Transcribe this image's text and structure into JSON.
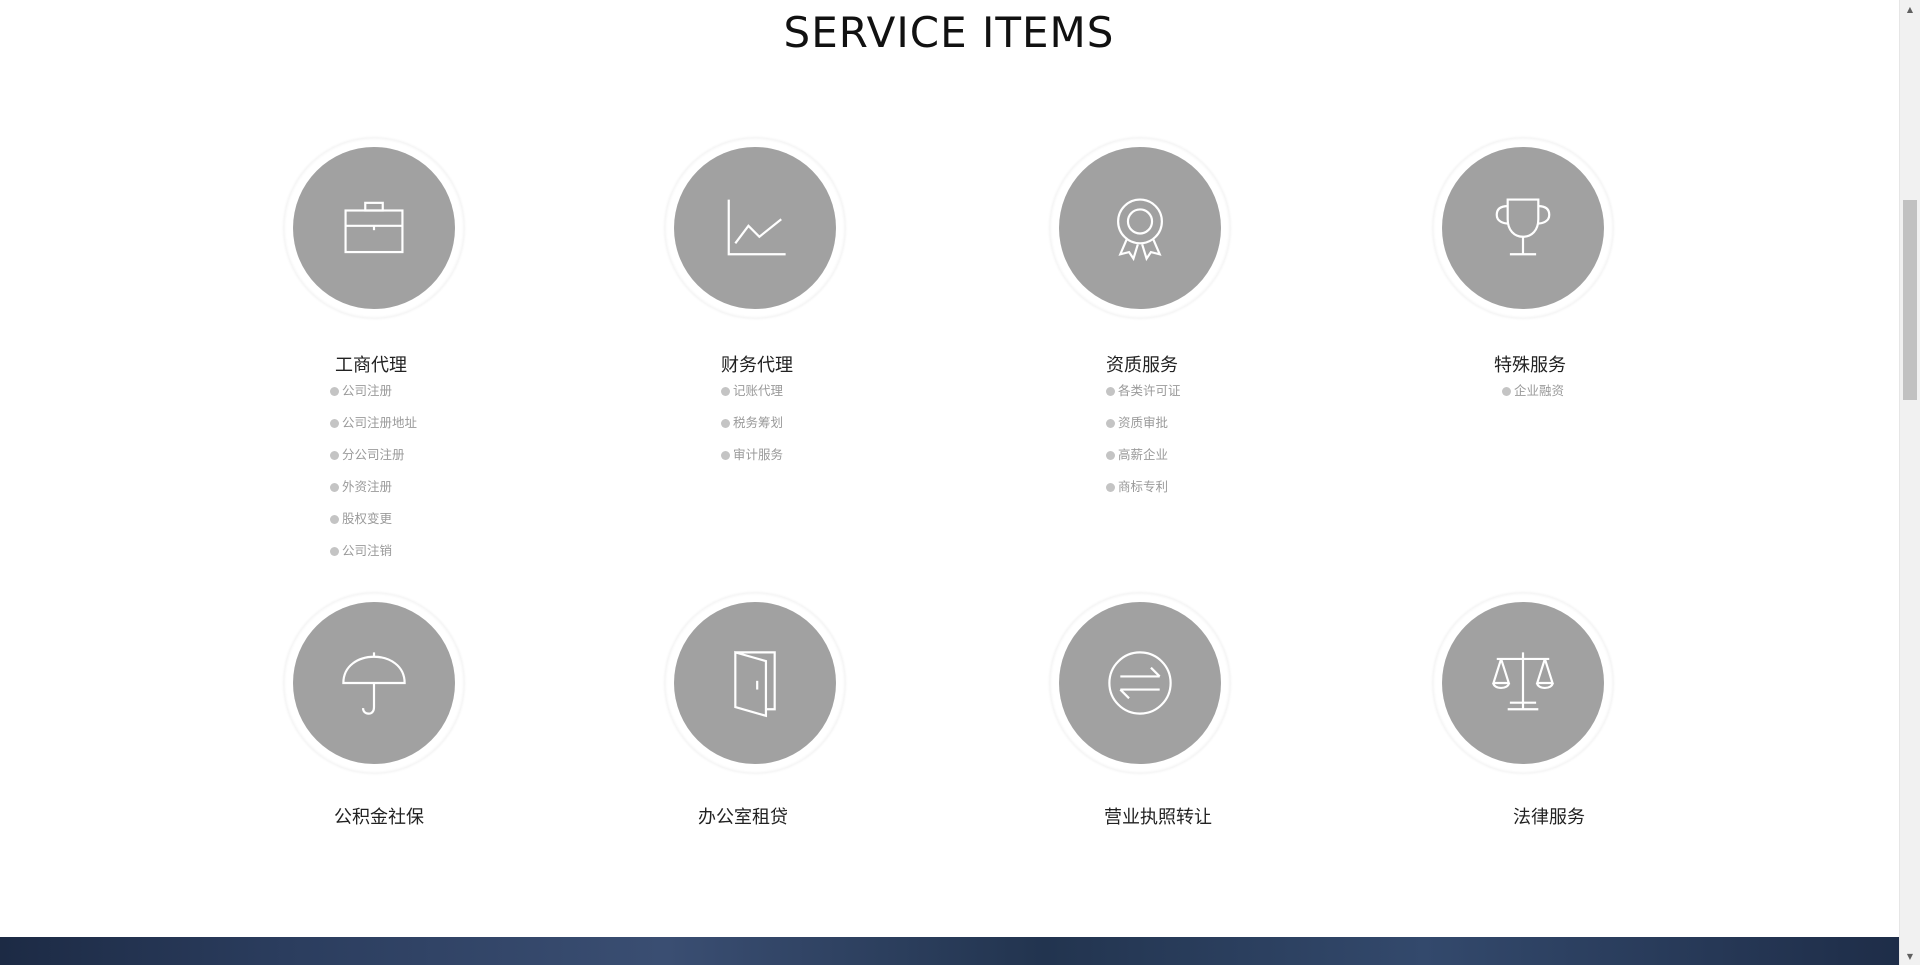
{
  "title": "SERVICE ITEMS",
  "services": [
    {
      "name": "工商代理",
      "icon": "briefcase-icon",
      "items": [
        "公司注册",
        "公司注册地址",
        "分公司注册",
        "外资注册",
        "股权变更",
        "公司注销"
      ]
    },
    {
      "name": "财务代理",
      "icon": "line-chart-icon",
      "items": [
        "记账代理",
        "税务筹划",
        "审计服务"
      ]
    },
    {
      "name": "资质服务",
      "icon": "award-ribbon-icon",
      "items": [
        "各类许可证",
        "资质审批",
        "高薪企业",
        "商标专利"
      ]
    },
    {
      "name": "特殊服务",
      "icon": "trophy-icon",
      "items": [
        "企业融资"
      ]
    },
    {
      "name": "公积金社保",
      "icon": "umbrella-icon",
      "items": []
    },
    {
      "name": "办公室租贷",
      "icon": "door-icon",
      "items": []
    },
    {
      "name": "营业执照转让",
      "icon": "exchange-arrows-icon",
      "items": []
    },
    {
      "name": "法律服务",
      "icon": "scales-icon",
      "items": []
    }
  ],
  "colors": {
    "circle": "#a1a1a1",
    "icon_stroke": "#ffffff",
    "sub_text": "#9a9a9a",
    "title_text": "#111111"
  }
}
